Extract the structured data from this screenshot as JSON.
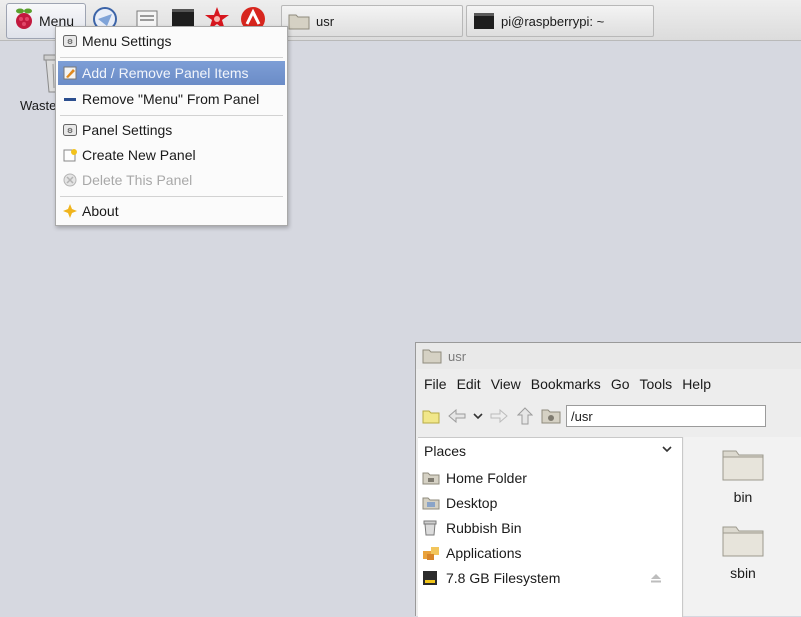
{
  "panel": {
    "menu_label": "Menu",
    "launchers": [
      "browser-icon",
      "file-manager-icon",
      "terminal-icon",
      "mathematica-icon",
      "wolfram-icon"
    ],
    "tasks": [
      {
        "label": "usr",
        "icon": "folder-icon"
      },
      {
        "label": "pi@raspberrypi: ~",
        "icon": "terminal-icon"
      }
    ]
  },
  "desktop": {
    "icon_label": "Waste",
    "icon": "wastebasket-icon"
  },
  "context_menu": {
    "items": [
      {
        "label": "Menu Settings",
        "icon": "settings-icon",
        "state": "normal"
      },
      {
        "label": "Add / Remove Panel Items",
        "icon": "edit-icon",
        "state": "selected"
      },
      {
        "label": "Remove \"Menu\" From Panel",
        "icon": "remove-icon",
        "state": "normal"
      },
      {
        "label": "Panel Settings",
        "icon": "settings-icon",
        "state": "normal"
      },
      {
        "label": "Create New Panel",
        "icon": "new-panel-icon",
        "state": "normal"
      },
      {
        "label": "Delete This Panel",
        "icon": "delete-icon",
        "state": "disabled"
      },
      {
        "label": "About",
        "icon": "about-icon",
        "state": "normal"
      }
    ]
  },
  "file_manager": {
    "title": "usr",
    "menubar": [
      "File",
      "Edit",
      "View",
      "Bookmarks",
      "Go",
      "Tools",
      "Help"
    ],
    "path": "/usr",
    "places_header": "Places",
    "places": [
      {
        "label": "Home Folder",
        "icon": "home-folder-icon"
      },
      {
        "label": "Desktop",
        "icon": "desktop-icon"
      },
      {
        "label": "Rubbish Bin",
        "icon": "trash-icon"
      },
      {
        "label": "Applications",
        "icon": "applications-icon"
      },
      {
        "label": "7.8 GB Filesystem",
        "icon": "drive-icon"
      }
    ],
    "files": [
      {
        "label": "bin",
        "icon": "folder-icon"
      },
      {
        "label": "sbin",
        "icon": "folder-icon"
      }
    ]
  },
  "colors": {
    "desktop_bg": "#d6d8e0",
    "menu_highlight": "#6b8cc7",
    "disabled_text": "#a8a8a8"
  }
}
